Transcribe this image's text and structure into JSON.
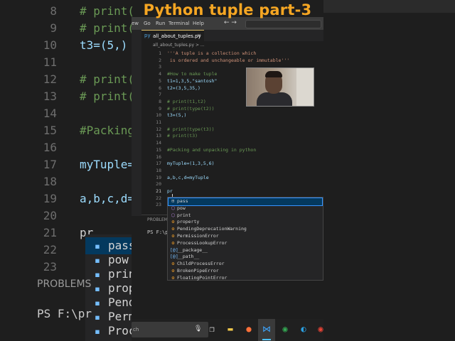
{
  "title": "Python tuple part-3",
  "background": {
    "lines": [
      {
        "num": "8",
        "code": "# print(",
        "kind": "cm"
      },
      {
        "num": "9",
        "code": "# print(",
        "kind": "cm"
      },
      {
        "num": "10",
        "code": "t3=(5,)",
        "kind": "var"
      },
      {
        "num": "11",
        "code": "",
        "kind": "var"
      },
      {
        "num": "12",
        "code": "# print(",
        "kind": "cm"
      },
      {
        "num": "13",
        "code": "# print(",
        "kind": "cm"
      },
      {
        "num": "14",
        "code": "",
        "kind": "var"
      },
      {
        "num": "15",
        "code": "#Packing",
        "kind": "cm"
      },
      {
        "num": "16",
        "code": "",
        "kind": "var"
      },
      {
        "num": "17",
        "code": "myTuple=",
        "kind": "var"
      },
      {
        "num": "18",
        "code": "",
        "kind": "var"
      },
      {
        "num": "19",
        "code": "a,b,c,d=",
        "kind": "var"
      },
      {
        "num": "20",
        "code": "",
        "kind": "var"
      },
      {
        "num": "21",
        "code": "pr",
        "kind": "cur"
      },
      {
        "num": "22",
        "code": "",
        "kind": "var"
      },
      {
        "num": "23",
        "code": "",
        "kind": "var"
      }
    ],
    "suggest": [
      "pass",
      "pow",
      "prin",
      "prop",
      "Pend",
      "Perm",
      "Proc"
    ],
    "problems": "PROBLEMS",
    "ps": "PS F:\\pr"
  },
  "menu": [
    "ew",
    "Go",
    "Run",
    "Terminal",
    "Help"
  ],
  "nav_arrows": "← →",
  "tab": {
    "icon": "py",
    "name": "all_about_tuples.py",
    "close": "×"
  },
  "breadcrumb": "all_about_tuples.py > ...",
  "code_lines": [
    {
      "n": "1",
      "text": "'''A tuple is a collection which",
      "cls": "c-str"
    },
    {
      "n": "2",
      "text": " is ordered and unchangeable or immutable'''",
      "cls": "c-str"
    },
    {
      "n": "3",
      "text": "",
      "cls": "c-op"
    },
    {
      "n": "4",
      "text": "#How to make tuple",
      "cls": "c-cm"
    },
    {
      "n": "5",
      "text": "t1=1,3,5,\"santosh\"",
      "cls": "c-var"
    },
    {
      "n": "6",
      "text": "t2=(3,5,35,)",
      "cls": "c-var"
    },
    {
      "n": "7",
      "text": "",
      "cls": "c-op"
    },
    {
      "n": "8",
      "text": "# print(t1,t2)",
      "cls": "c-cm"
    },
    {
      "n": "9",
      "text": "# print(type(t2))",
      "cls": "c-cm"
    },
    {
      "n": "10",
      "text": "t3=(5,)",
      "cls": "c-var"
    },
    {
      "n": "11",
      "text": "",
      "cls": "c-op"
    },
    {
      "n": "12",
      "text": "# print(type(t3))",
      "cls": "c-cm"
    },
    {
      "n": "13",
      "text": "# print(t3)",
      "cls": "c-cm"
    },
    {
      "n": "14",
      "text": "",
      "cls": "c-op"
    },
    {
      "n": "15",
      "text": "#Packing and unpacking in python",
      "cls": "c-cm"
    },
    {
      "n": "16",
      "text": "",
      "cls": "c-op"
    },
    {
      "n": "17",
      "text": "myTuple=(1,3,5,6)",
      "cls": "c-var"
    },
    {
      "n": "18",
      "text": "",
      "cls": "c-op"
    },
    {
      "n": "19",
      "text": "a,b,c,d=myTuple",
      "cls": "c-var"
    },
    {
      "n": "20",
      "text": "",
      "cls": "c-op"
    },
    {
      "n": "21",
      "text": "pr",
      "cls": "c-var"
    },
    {
      "n": "22",
      "text": "",
      "cls": "c-op"
    },
    {
      "n": "23",
      "text": "",
      "cls": "c-op"
    }
  ],
  "active_line": "21",
  "panel": {
    "header": "PROBLEMS",
    "prompt": "PS F:\\pr"
  },
  "suggestions": [
    {
      "label": "pass",
      "icon": "keyword-icon",
      "glyph": "⊟",
      "cls": "ic-kw"
    },
    {
      "label": "pow",
      "icon": "function-icon",
      "glyph": "⬡",
      "cls": "ic-fn"
    },
    {
      "label": "print",
      "icon": "function-icon",
      "glyph": "⬡",
      "cls": "ic-fn"
    },
    {
      "label": "property",
      "icon": "class-icon",
      "glyph": "⚙",
      "cls": "ic-cls"
    },
    {
      "label": "PendingDeprecationWarning",
      "icon": "class-icon",
      "glyph": "⚙",
      "cls": "ic-cls"
    },
    {
      "label": "PermissionError",
      "icon": "class-icon",
      "glyph": "⚙",
      "cls": "ic-cls"
    },
    {
      "label": "ProcessLookupError",
      "icon": "class-icon",
      "glyph": "⚙",
      "cls": "ic-cls"
    },
    {
      "label": "__package__",
      "icon": "variable-icon",
      "glyph": "[@]",
      "cls": "ic-var"
    },
    {
      "label": "__path__",
      "icon": "variable-icon",
      "glyph": "[@]",
      "cls": "ic-var"
    },
    {
      "label": "ChildProcessError",
      "icon": "class-icon",
      "glyph": "⚙",
      "cls": "ic-cls"
    },
    {
      "label": "BrokenPipeError",
      "icon": "class-icon",
      "glyph": "⚙",
      "cls": "ic-cls"
    },
    {
      "label": "FloatingPointError",
      "icon": "class-icon",
      "glyph": "⚙",
      "cls": "ic-cls"
    }
  ],
  "taskbar": {
    "search_text": "ch",
    "items": [
      {
        "name": "task-view-icon",
        "glyph": "❐",
        "color": "#dddddd"
      },
      {
        "name": "file-explorer-icon",
        "glyph": "▬",
        "color": "#f2c94c"
      },
      {
        "name": "firefox-icon",
        "glyph": "●",
        "color": "#ff7139"
      },
      {
        "name": "vscode-icon",
        "glyph": "⋈",
        "color": "#3ea6ff"
      },
      {
        "name": "chrome-icon",
        "glyph": "◉",
        "color": "#34a853"
      },
      {
        "name": "edge-icon",
        "glyph": "◐",
        "color": "#2b9fe0"
      },
      {
        "name": "chrome-profile-icon",
        "glyph": "◉",
        "color": "#ea4335"
      }
    ]
  },
  "colors": {
    "title": "#f5a623",
    "accent": "#3794ff",
    "selection": "#04395e"
  }
}
